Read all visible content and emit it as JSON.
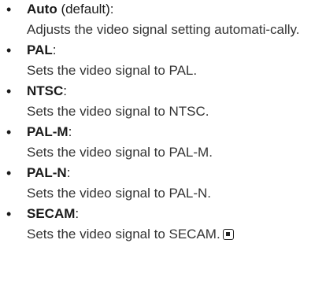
{
  "options": [
    {
      "name": "Auto",
      "suffix": " (default):",
      "description": "Adjusts the video signal setting automati-cally."
    },
    {
      "name": "PAL",
      "suffix": ":",
      "description": "Sets the video signal to PAL."
    },
    {
      "name": "NTSC",
      "suffix": ":",
      "description": "Sets the video signal to NTSC."
    },
    {
      "name": "PAL-M",
      "suffix": ":",
      "description": "Sets the video signal to PAL-M."
    },
    {
      "name": "PAL-N",
      "suffix": ":",
      "description": "Sets the video signal to PAL-N."
    },
    {
      "name": "SECAM",
      "suffix": ":",
      "description": "Sets the video signal to SECAM."
    }
  ],
  "end_icon": "end-of-section-icon"
}
